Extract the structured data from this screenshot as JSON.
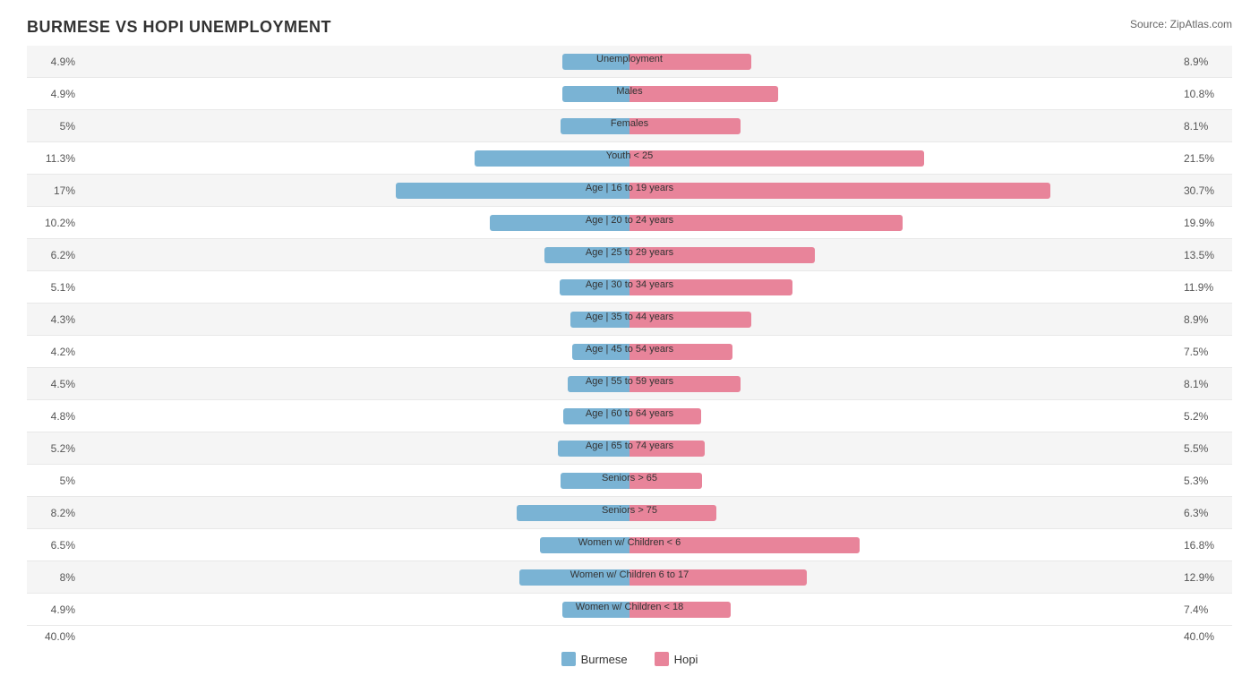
{
  "title": "BURMESE VS HOPI UNEMPLOYMENT",
  "source": "Source: ZipAtlas.com",
  "colors": {
    "burmese": "#7ab3d4",
    "hopi": "#e8849a"
  },
  "legend": {
    "burmese": "Burmese",
    "hopi": "Hopi"
  },
  "x_axis": {
    "left": "40.0%",
    "right": "40.0%"
  },
  "max_val": 40.0,
  "rows": [
    {
      "label": "Unemployment",
      "burmese": 4.9,
      "hopi": 8.9
    },
    {
      "label": "Males",
      "burmese": 4.9,
      "hopi": 10.8
    },
    {
      "label": "Females",
      "burmese": 5.0,
      "hopi": 8.1
    },
    {
      "label": "Youth < 25",
      "burmese": 11.3,
      "hopi": 21.5
    },
    {
      "label": "Age | 16 to 19 years",
      "burmese": 17.0,
      "hopi": 30.7
    },
    {
      "label": "Age | 20 to 24 years",
      "burmese": 10.2,
      "hopi": 19.9
    },
    {
      "label": "Age | 25 to 29 years",
      "burmese": 6.2,
      "hopi": 13.5
    },
    {
      "label": "Age | 30 to 34 years",
      "burmese": 5.1,
      "hopi": 11.9
    },
    {
      "label": "Age | 35 to 44 years",
      "burmese": 4.3,
      "hopi": 8.9
    },
    {
      "label": "Age | 45 to 54 years",
      "burmese": 4.2,
      "hopi": 7.5
    },
    {
      "label": "Age | 55 to 59 years",
      "burmese": 4.5,
      "hopi": 8.1
    },
    {
      "label": "Age | 60 to 64 years",
      "burmese": 4.8,
      "hopi": 5.2
    },
    {
      "label": "Age | 65 to 74 years",
      "burmese": 5.2,
      "hopi": 5.5
    },
    {
      "label": "Seniors > 65",
      "burmese": 5.0,
      "hopi": 5.3
    },
    {
      "label": "Seniors > 75",
      "burmese": 8.2,
      "hopi": 6.3
    },
    {
      "label": "Women w/ Children < 6",
      "burmese": 6.5,
      "hopi": 16.8
    },
    {
      "label": "Women w/ Children 6 to 17",
      "burmese": 8.0,
      "hopi": 12.9
    },
    {
      "label": "Women w/ Children < 18",
      "burmese": 4.9,
      "hopi": 7.4
    }
  ]
}
